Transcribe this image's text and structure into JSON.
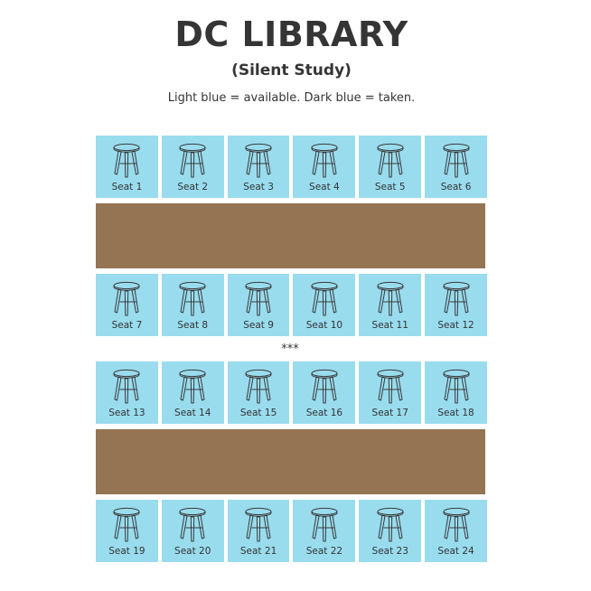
{
  "header": {
    "title": "DC LIBRARY",
    "subtitle": "(Silent Study)",
    "legend": "Light blue = available. Dark blue = taken."
  },
  "colors": {
    "available": "#99dcee",
    "taken": "#2f6ea3",
    "table": "#957454"
  },
  "separator": "***",
  "seats": [
    {
      "label": "Seat 1",
      "status": "available"
    },
    {
      "label": "Seat 2",
      "status": "available"
    },
    {
      "label": "Seat 3",
      "status": "available"
    },
    {
      "label": "Seat 4",
      "status": "available"
    },
    {
      "label": "Seat 5",
      "status": "available"
    },
    {
      "label": "Seat 6",
      "status": "available"
    },
    {
      "label": "Seat 7",
      "status": "available"
    },
    {
      "label": "Seat 8",
      "status": "available"
    },
    {
      "label": "Seat 9",
      "status": "available"
    },
    {
      "label": "Seat 10",
      "status": "available"
    },
    {
      "label": "Seat 11",
      "status": "available"
    },
    {
      "label": "Seat 12",
      "status": "available"
    },
    {
      "label": "Seat 13",
      "status": "available"
    },
    {
      "label": "Seat 14",
      "status": "available"
    },
    {
      "label": "Seat 15",
      "status": "available"
    },
    {
      "label": "Seat 16",
      "status": "available"
    },
    {
      "label": "Seat 17",
      "status": "available"
    },
    {
      "label": "Seat 18",
      "status": "available"
    },
    {
      "label": "Seat 19",
      "status": "available"
    },
    {
      "label": "Seat 20",
      "status": "available"
    },
    {
      "label": "Seat 21",
      "status": "available"
    },
    {
      "label": "Seat 22",
      "status": "available"
    },
    {
      "label": "Seat 23",
      "status": "available"
    },
    {
      "label": "Seat 24",
      "status": "available"
    }
  ],
  "seat_icon": "stool-icon"
}
